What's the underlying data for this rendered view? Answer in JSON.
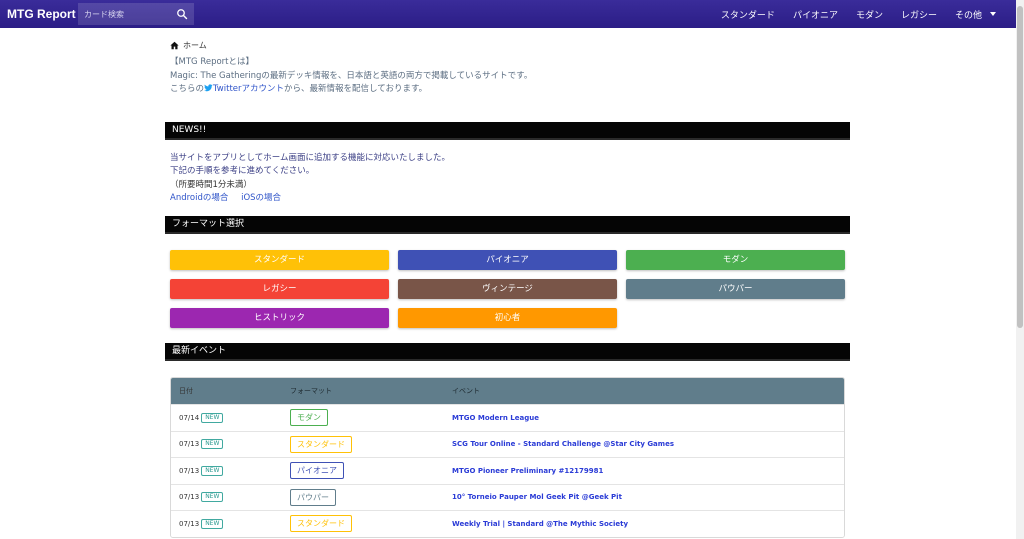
{
  "navbar": {
    "brand": "MTG Report",
    "search_placeholder": "カード検索",
    "links": [
      "スタンダード",
      "パイオニア",
      "モダン",
      "レガシー",
      "その他"
    ]
  },
  "breadcrumb": {
    "home": "ホーム"
  },
  "intro": {
    "line1": "【MTG Reportとは】",
    "line2": "Magic: The Gatheringの最新デッキ情報を、日本語と英語の両方で掲載しているサイトです。",
    "line3_pre": "こちらの",
    "line3_link": "Twitterアカウント",
    "line3_post": "から、最新情報を配信しております。"
  },
  "news": {
    "header": "NEWS!!",
    "line1": "当サイトをアプリとしてホーム画面に追加する機能に対応いたしました。",
    "line2": "下記の手順を参考に進めてください。",
    "line3": "（所要時間1分未満）",
    "link_android": "Androidの場合",
    "link_ios": "iOSの場合"
  },
  "formats": {
    "header": "フォーマット選択",
    "buttons": [
      {
        "label": "スタンダード",
        "color": "#ffc107"
      },
      {
        "label": "パイオニア",
        "color": "#3f51b5"
      },
      {
        "label": "モダン",
        "color": "#4caf50"
      },
      {
        "label": "レガシー",
        "color": "#f44336"
      },
      {
        "label": "ヴィンテージ",
        "color": "#795548"
      },
      {
        "label": "パウパー",
        "color": "#607d8b"
      },
      {
        "label": "ヒストリック",
        "color": "#9c27b0"
      },
      {
        "label": "初心者",
        "color": "#ff9800"
      }
    ]
  },
  "events": {
    "header": "最新イベント",
    "columns": [
      "日付",
      "フォーマット",
      "イベント"
    ],
    "badge": "NEW",
    "rows": [
      {
        "date": "07/14",
        "format": "モダン",
        "format_color": "#4caf50",
        "event": "MTGO Modern League"
      },
      {
        "date": "07/13",
        "format": "スタンダード",
        "format_color": "#ffc107",
        "event": "SCG Tour Online - Standard Challenge @Star City Games"
      },
      {
        "date": "07/13",
        "format": "パイオニア",
        "format_color": "#3f51b5",
        "event": "MTGO Pioneer Preliminary #12179981"
      },
      {
        "date": "07/13",
        "format": "パウパー",
        "format_color": "#607d8b",
        "event": "10° Torneio Pauper Mol Geek Pit @Geek Pit"
      },
      {
        "date": "07/13",
        "format": "スタンダード",
        "format_color": "#ffc107",
        "event": "Weekly Trial | Standard @The Mythic Society"
      }
    ]
  }
}
